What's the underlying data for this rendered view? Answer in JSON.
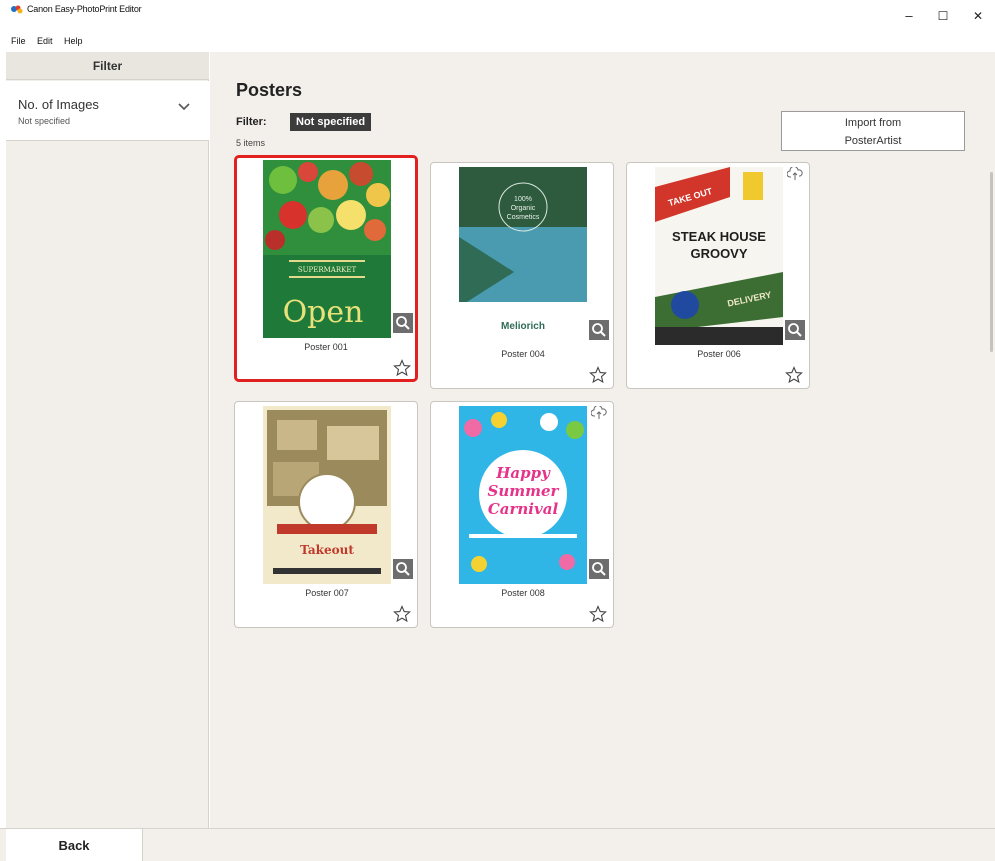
{
  "window": {
    "title": "Canon Easy-PhotoPrint Editor",
    "minimize": "–",
    "maximize": "☐",
    "close": "✕"
  },
  "menu": [
    "File",
    "Edit",
    "Help"
  ],
  "sidebar": {
    "header": "Filter",
    "filters": [
      {
        "label": "No. of Images",
        "value": "Not specified",
        "icon": "chevron-down-icon"
      }
    ]
  },
  "main": {
    "title": "Posters",
    "filter_label": "Filter:",
    "filter_chip": "Not specified",
    "count": "5 items",
    "import_button": [
      "Import from",
      "PosterArtist"
    ]
  },
  "cards": [
    {
      "name": "Poster 001",
      "selected": true,
      "cloud": false,
      "thumb_text": [
        "SUPERMARKET",
        "Open"
      ]
    },
    {
      "name": "Poster 004",
      "selected": false,
      "cloud": false,
      "thumb_text": [
        "100%",
        "Organic",
        "Cosmetics",
        "Meliorich"
      ]
    },
    {
      "name": "Poster 006",
      "selected": false,
      "cloud": true,
      "thumb_text": [
        "TAKE OUT",
        "STEAK HOUSE",
        "GROOVY",
        "DELIVERY"
      ]
    },
    {
      "name": "Poster 007",
      "selected": false,
      "cloud": false,
      "thumb_text": [
        "Takeout"
      ]
    },
    {
      "name": "Poster 008",
      "selected": false,
      "cloud": true,
      "thumb_text": [
        "Happy",
        "Summer",
        "Carnival"
      ]
    }
  ],
  "bottom": {
    "back": "Back"
  },
  "colors": {
    "selection": "#e0211f",
    "sidebar_bg": "#f2efea",
    "main_bg": "#f3f0eb"
  }
}
